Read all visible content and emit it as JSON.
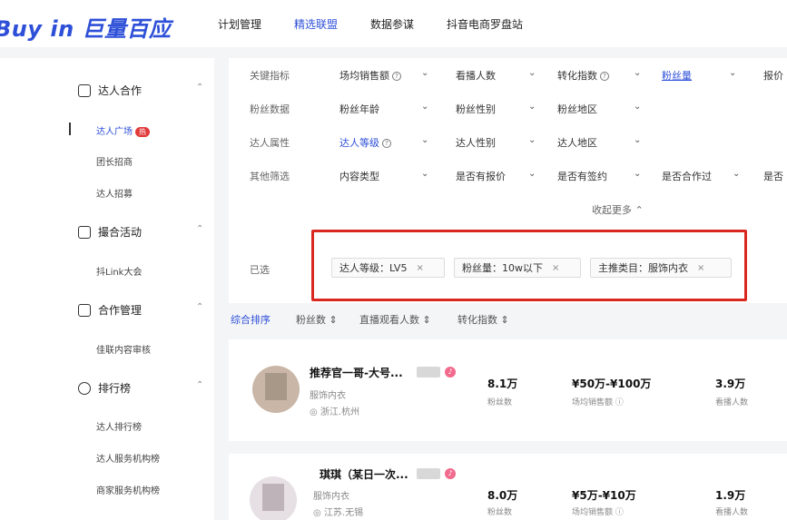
{
  "header": {
    "logo": "Buy in 巨量百应",
    "nav": [
      {
        "label": "计划管理",
        "active": false
      },
      {
        "label": "精选联盟",
        "active": true
      },
      {
        "label": "数据参谋",
        "active": false
      },
      {
        "label": "抖音电商罗盘站",
        "active": false
      }
    ]
  },
  "sidebar": {
    "groups": [
      {
        "label": "达人合作",
        "items": [
          "达人广场",
          "团长招商",
          "达人招募"
        ],
        "badge": "热"
      },
      {
        "label": "撮合活动",
        "items": [
          "抖Link大会"
        ]
      },
      {
        "label": "合作管理",
        "items": [
          "佳联内容审核"
        ]
      },
      {
        "label": "排行榜",
        "items": [
          "达人排行榜",
          "达人服务机构榜",
          "商家服务机构榜"
        ]
      }
    ]
  },
  "filters": {
    "rows": [
      {
        "label": "关键指标",
        "selects": [
          "场均销售额",
          "看播人数",
          "转化指数",
          "粉丝量",
          "报价"
        ]
      },
      {
        "label": "粉丝数据",
        "selects": [
          "粉丝年龄",
          "粉丝性别",
          "粉丝地区"
        ]
      },
      {
        "label": "达人属性",
        "selects": [
          "达人等级",
          "达人性别",
          "达人地区"
        ]
      },
      {
        "label": "其他筛选",
        "selects": [
          "内容类型",
          "是否有报价",
          "是否有签约",
          "是否合作过",
          "是否"
        ]
      }
    ],
    "collapse_label": "收起更多",
    "selected_label": "已选",
    "selected_tags": [
      "达人等级：LV5",
      "粉丝量：10w以下",
      "主推类目：服饰内衣"
    ]
  },
  "sort": {
    "items": [
      "综合排序",
      "粉丝数",
      "直播观看人数",
      "转化指数"
    ]
  },
  "creators": [
    {
      "name": "推荐官一哥-大号...",
      "category": "服饰内衣",
      "location": "浙江.杭州",
      "fans": "8.1万",
      "fans_caption": "粉丝数",
      "sales": "¥50万-¥100万",
      "sales_caption": "场均销售额",
      "viewers": "3.9万",
      "viewers_caption": "看播人数"
    },
    {
      "name": "琪琪（某日一次...",
      "category": "服饰内衣",
      "location": "江苏.无锡",
      "fans": "8.0万",
      "fans_caption": "粉丝数",
      "sales": "¥5万-¥10万",
      "sales_caption": "场均销售额",
      "viewers": "1.9万",
      "viewers_caption": "看播人数"
    }
  ]
}
